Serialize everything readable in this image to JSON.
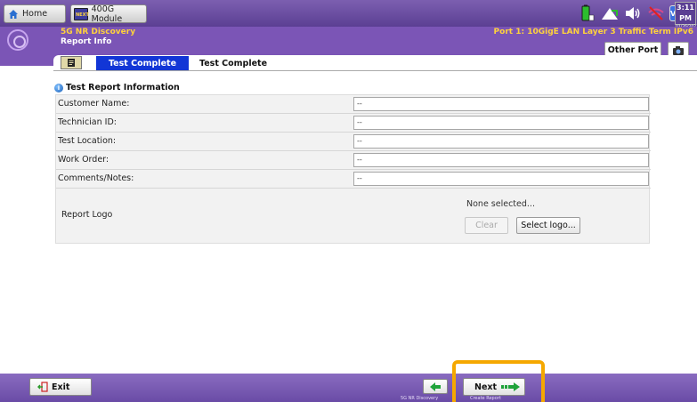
{
  "topbar": {
    "home_label": "Home",
    "module_label": "400G Module",
    "module_icon_text": "NEXT",
    "clock_time": "3:11 PM",
    "clock_date": "01/26/2023",
    "status_badge": "V8"
  },
  "header": {
    "test_name": "5G NR Discovery",
    "page_name": "Report Info",
    "port_info": "Port 1: 10GigE LAN Layer 3 Traffic Term IPv6",
    "other_port_label": "Other Port"
  },
  "tabs": [
    {
      "label": "Test Complete",
      "active": true
    },
    {
      "label": "Test Complete",
      "active": false
    }
  ],
  "report": {
    "section_title": "Test Report Information",
    "fields": [
      {
        "label": "Customer Name:",
        "value": "--"
      },
      {
        "label": "Technician ID:",
        "value": "--"
      },
      {
        "label": "Test Location:",
        "value": "--"
      },
      {
        "label": "Work Order:",
        "value": "--"
      },
      {
        "label": "Comments/Notes:",
        "value": "--"
      }
    ],
    "logo_label": "Report Logo",
    "logo_status": "None selected...",
    "clear_label": "Clear",
    "select_logo_label": "Select logo..."
  },
  "bottombar": {
    "exit_label": "Exit",
    "back_caption": "5G NR Discovery",
    "next_label": "Next",
    "next_caption": "Create Report"
  },
  "colors": {
    "purple_bar": "#7b55b6",
    "accent_yellow": "#ffd23c",
    "tab_active_blue": "#1236d6",
    "highlight_orange": "#f5a800",
    "arrow_green": "#1fa33a"
  }
}
